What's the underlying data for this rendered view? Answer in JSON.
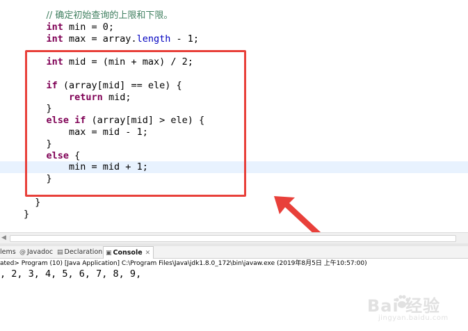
{
  "editor": {
    "lines": [
      {
        "indent": "    ",
        "parts": [
          {
            "t": "cm",
            "v": "// 确定初始查询的上限和下限。"
          }
        ]
      },
      {
        "indent": "    ",
        "parts": [
          {
            "t": "kw",
            "v": "int"
          },
          {
            "t": "tx",
            "v": " min = 0;"
          }
        ]
      },
      {
        "indent": "    ",
        "parts": [
          {
            "t": "kw",
            "v": "int"
          },
          {
            "t": "tx",
            "v": " max = array."
          },
          {
            "t": "fld",
            "v": "length"
          },
          {
            "t": "tx",
            "v": " - 1;"
          }
        ]
      },
      {
        "indent": "",
        "parts": []
      },
      {
        "indent": "    ",
        "parts": [
          {
            "t": "kw",
            "v": "int"
          },
          {
            "t": "tx",
            "v": " mid = (min + max) / 2;"
          }
        ]
      },
      {
        "indent": "",
        "parts": []
      },
      {
        "indent": "    ",
        "parts": [
          {
            "t": "kw",
            "v": "if"
          },
          {
            "t": "tx",
            "v": " (array[mid] == ele) {"
          }
        ]
      },
      {
        "indent": "        ",
        "parts": [
          {
            "t": "kw",
            "v": "return"
          },
          {
            "t": "tx",
            "v": " mid;"
          }
        ]
      },
      {
        "indent": "    ",
        "parts": [
          {
            "t": "tx",
            "v": "}"
          }
        ]
      },
      {
        "indent": "    ",
        "parts": [
          {
            "t": "kw",
            "v": "else if"
          },
          {
            "t": "tx",
            "v": " (array[mid] > ele) {"
          }
        ]
      },
      {
        "indent": "        ",
        "parts": [
          {
            "t": "tx",
            "v": "max = mid - 1;"
          }
        ]
      },
      {
        "indent": "    ",
        "parts": [
          {
            "t": "tx",
            "v": "}"
          }
        ]
      },
      {
        "indent": "    ",
        "parts": [
          {
            "t": "kw",
            "v": "else"
          },
          {
            "t": "tx",
            "v": " {"
          }
        ]
      },
      {
        "indent": "        ",
        "parts": [
          {
            "t": "tx",
            "v": "min = mid + 1;"
          }
        ],
        "current": true
      },
      {
        "indent": "    ",
        "parts": [
          {
            "t": "tx",
            "v": "}"
          }
        ]
      },
      {
        "indent": "",
        "parts": []
      },
      {
        "indent": "  ",
        "parts": [
          {
            "t": "tx",
            "v": "}"
          }
        ]
      },
      {
        "indent": "",
        "parts": [
          {
            "t": "tx",
            "v": "}"
          }
        ]
      }
    ]
  },
  "tabs": [
    {
      "key": "problems",
      "label": "lems",
      "icon": ""
    },
    {
      "key": "javadoc",
      "label": "Javadoc",
      "icon": "@"
    },
    {
      "key": "declaration",
      "label": "Declaration",
      "icon": "▤"
    },
    {
      "key": "console",
      "label": "Console",
      "icon": "▣",
      "close": "✕"
    }
  ],
  "console": {
    "launch_info": "ated> Program (10) [Java Application] C:\\Program Files\\Java\\jdk1.8.0_172\\bin\\javaw.exe (2019年8月5日 上午10:57:00)",
    "output": ", 2, 3, 4, 5, 6, 7, 8, 9,"
  },
  "watermark": {
    "text": "Bai  经验",
    "sub": "jingyan.baidu.com"
  },
  "colors": {
    "keyword": "#7f0055",
    "comment": "#3f7f5f",
    "field": "#0000c0",
    "annotation_red": "#e8403a",
    "current_line": "#e8f2fe"
  }
}
